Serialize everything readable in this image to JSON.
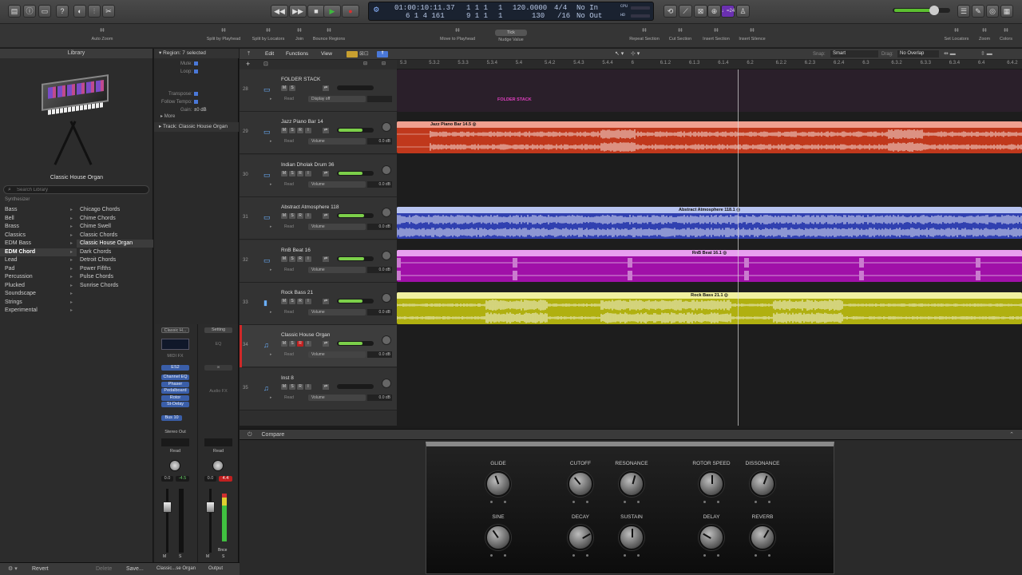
{
  "control_bar": {
    "position_time": "01:00:10:11.37",
    "position_bars": "6  1  4  161",
    "bars_top": "1  1  1",
    "bars_bot": "9  1  1",
    "one_top": "1",
    "one_bot": "1",
    "tempo": "120.0000",
    "tempo_sub": "130",
    "signature": "4/4",
    "division": "/16",
    "in_status": "No In",
    "out_status": "No Out",
    "cpu_label": "CPU",
    "hd_label": "HD",
    "count_in": "♩=24"
  },
  "toolbar": {
    "items": [
      {
        "label": "Auto Zoom",
        "icon": "auto-zoom-icon"
      },
      {
        "label": "Split by Playhead",
        "icon": "scissors-icon"
      },
      {
        "label": "Split by Locators",
        "icon": "scissors-icon"
      },
      {
        "label": "Join",
        "icon": "join-icon"
      },
      {
        "label": "Bounce Regions",
        "icon": "bounce-icon"
      },
      {
        "label": "Move to Playhead",
        "icon": "move-icon"
      },
      {
        "label": "Nudge Value",
        "icon": "nudge-icon",
        "value": "Tick"
      },
      {
        "label": "Repeat Section",
        "icon": "repeat-icon"
      },
      {
        "label": "Cut Section",
        "icon": "cut-icon"
      },
      {
        "label": "Insert Section",
        "icon": "insert-icon"
      },
      {
        "label": "Insert Silence",
        "icon": "silence-icon"
      },
      {
        "label": "Set Locators",
        "icon": "locators-icon"
      },
      {
        "label": "Zoom",
        "icon": "zoom-icon"
      },
      {
        "label": "Colors",
        "icon": "colors-icon"
      }
    ]
  },
  "library": {
    "title": "Library",
    "patch_name": "Classic House Organ",
    "search_placeholder": "Search Library",
    "section": "Synthesizer",
    "categories": [
      "Bass",
      "Bell",
      "Brass",
      "Classics",
      "EDM Bass",
      "EDM Chord",
      "Lead",
      "Pad",
      "Percussion",
      "Plucked",
      "Soundscape",
      "Strings",
      "Experimental"
    ],
    "selected_category": "EDM Chord",
    "patches": [
      "Chicago Chords",
      "Chime Chords",
      "Chime Swell",
      "Classic Chords",
      "Classic House Organ",
      "Dark Chords",
      "Detroit Chords",
      "Power Fifths",
      "Pulse Chords",
      "Sunrise Chords"
    ],
    "selected_patch": "Classic House Organ",
    "footer": {
      "revert": "Revert",
      "delete": "Delete",
      "save": "Save..."
    }
  },
  "inspector": {
    "region_header": "Region: 7 selected",
    "rows": [
      {
        "label": "Mute:",
        "value": ""
      },
      {
        "label": "Loop:",
        "value": ""
      },
      {
        "label": "Transpose:",
        "value": ""
      },
      {
        "label": "Follow Tempo:",
        "value": ""
      },
      {
        "label": "Gain:",
        "value": "±0 dB"
      }
    ],
    "more": "More",
    "track_header": "Track: Classic House Organ",
    "strip1": {
      "setting": "Classic H...",
      "midi_fx": "MIDI FX",
      "instrument": "ES2",
      "plugins": [
        "Channel EQ",
        "Phaser",
        "Pedalboard",
        "Rotor",
        "St-Delay"
      ],
      "send": "Bus 10",
      "output": "Stereo Out",
      "mode": "Read",
      "vol": "0.0",
      "peak": "-4.5",
      "name": "Classic...se Organ"
    },
    "strip2": {
      "setting": "Setting",
      "eq": "EQ",
      "audio_fx": "Audio FX",
      "mode": "Read",
      "vol": "0.0",
      "peak": "4.4",
      "bnce": "Bnce",
      "name": "Output"
    }
  },
  "tracks_header": {
    "edit": "Edit",
    "functions": "Functions",
    "view": "View",
    "snap_label": "Snap:",
    "snap_value": "Smart",
    "drag_label": "Drag:",
    "drag_value": "No Overlap"
  },
  "ruler": [
    "5.3",
    "5.3.2",
    "5.3.3",
    "5.3.4",
    "5.4",
    "5.4.2",
    "5.4.3",
    "5.4.4",
    "6",
    "6.1.2",
    "6.1.3",
    "6.1.4",
    "6.2",
    "6.2.2",
    "6.2.3",
    "6.2.4",
    "6.3",
    "6.3.2",
    "6.3.3",
    "6.3.4",
    "6.4",
    "6.4.2"
  ],
  "tracks": [
    {
      "num": "28",
      "name": "FOLDER STACK",
      "mode": "Read",
      "param": "Display off",
      "db": "",
      "icon": "folder-icon",
      "fader": 0
    },
    {
      "num": "29",
      "name": "Jazz Piano Bar 14",
      "mode": "Read",
      "param": "Volume",
      "db": "0.0 dB",
      "icon": "audio-icon",
      "fader": 0.75
    },
    {
      "num": "30",
      "name": "Indian Dholak Drum 36",
      "mode": "Read",
      "param": "Volume",
      "db": "0.0 dB",
      "icon": "audio-icon",
      "fader": 0.75
    },
    {
      "num": "31",
      "name": "Abstract Atmosphere 118",
      "mode": "Read",
      "param": "Volume",
      "db": "0.0 dB",
      "icon": "audio-icon",
      "fader": 0.8
    },
    {
      "num": "32",
      "name": "RnB Beat 16",
      "mode": "Read",
      "param": "Volume",
      "db": "0.0 dB",
      "icon": "audio-icon",
      "fader": 0.8
    },
    {
      "num": "33",
      "name": "Rock Bass 21",
      "mode": "Read",
      "param": "Volume",
      "db": "0.0 dB",
      "icon": "amp-icon",
      "fader": 0.75
    },
    {
      "num": "34",
      "name": "Classic House Organ",
      "mode": "Read",
      "param": "Volume",
      "db": "0.0 dB",
      "icon": "keyboard-icon",
      "fader": 0.75
    },
    {
      "num": "35",
      "name": "Inst 8",
      "mode": "Read",
      "param": "Volume",
      "db": "0.0 dB",
      "icon": "keyboard-icon",
      "fader": 0
    }
  ],
  "regions": [
    {
      "label": "FOLDER STACK",
      "color": "#2a1f2a",
      "text": "#e040c0"
    },
    {
      "label": "Jazz Piano Bar 14.5 ◎",
      "color": "#c0381c",
      "head": "#f0a090"
    },
    {
      "label": "Abstract Atmosphere 118.1 ◎",
      "color": "#3040b0",
      "head": "#b8c4f0"
    },
    {
      "label": "RnB Beat 16.1 ◎",
      "color": "#a010a8",
      "head": "#e8a0f0"
    },
    {
      "label": "Rock Bass 21.1 ◎",
      "color": "#b0b010",
      "head": "#f0f0a0"
    }
  ],
  "plugin": {
    "compare": "Compare",
    "knobs": [
      {
        "label": "GLIDE",
        "angle": -20
      },
      {
        "label": "CUTOFF",
        "angle": -40
      },
      {
        "label": "RESONANCE",
        "angle": 15
      },
      {
        "label": "ROTOR SPEED",
        "angle": 0
      },
      {
        "label": "DISSONANCE",
        "angle": 20
      },
      {
        "label": "SINE",
        "angle": -35
      },
      {
        "label": "DECAY",
        "angle": 60
      },
      {
        "label": "SUSTAIN",
        "angle": 0
      },
      {
        "label": "DELAY",
        "angle": -60
      },
      {
        "label": "REVERB",
        "angle": 30
      }
    ]
  },
  "colors": {
    "play": "#3fb83f",
    "record": "#d83030",
    "accent": "#4a78d8"
  }
}
